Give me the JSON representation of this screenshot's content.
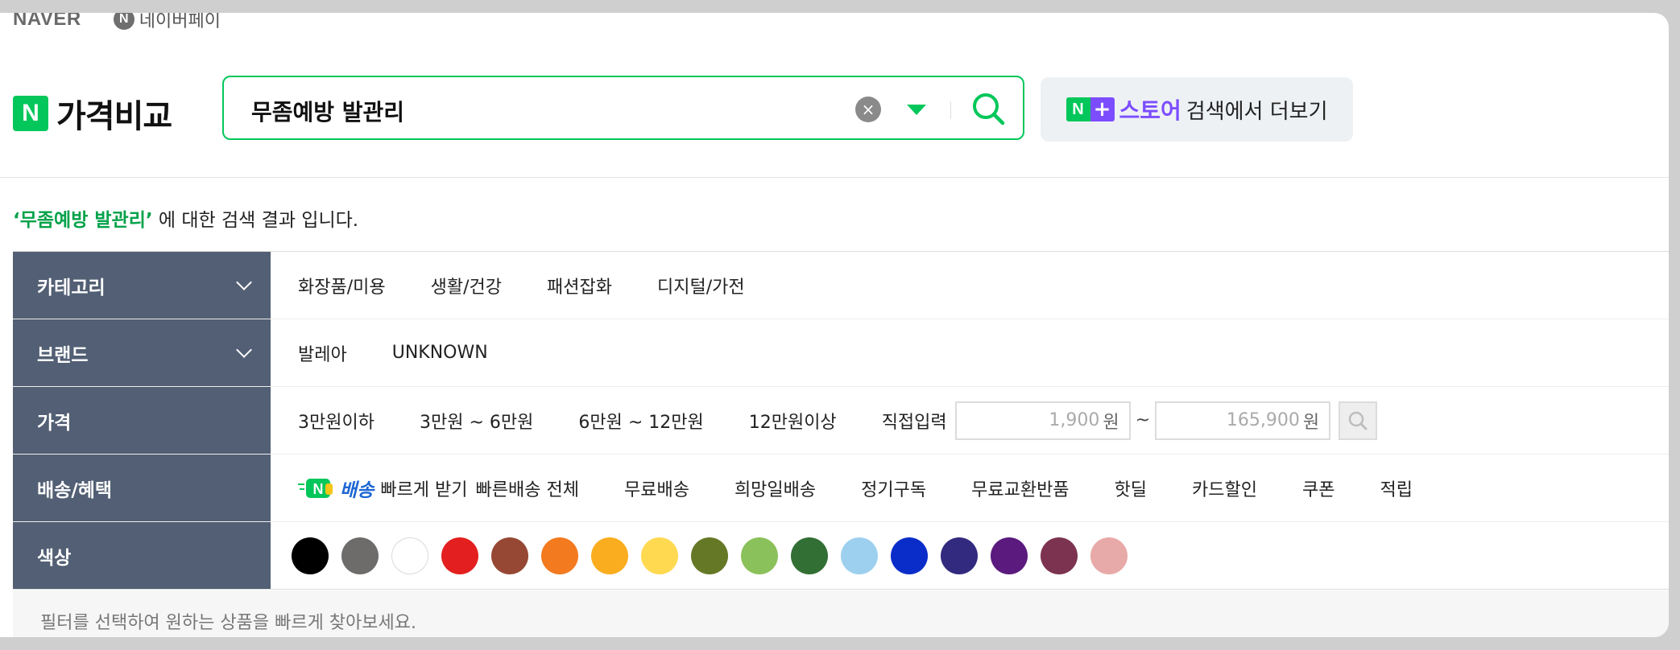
{
  "top": {
    "naver": "NAVER",
    "npay_icon": "N",
    "npay": "네이버페이"
  },
  "brand": {
    "icon": "N",
    "title": "가격비교"
  },
  "search": {
    "query": "무좀예방 발관리",
    "clear_icon": "×"
  },
  "store": {
    "n": "N",
    "plus": "+",
    "name": "스토어",
    "rest": "검색에서 더보기"
  },
  "result": {
    "keyword": "‘무좀예방 발관리’",
    "text": " 에 대한 검색 결과 입니다."
  },
  "filters": {
    "category": {
      "label": "카테고리",
      "items": [
        "화장품/미용",
        "생활/건강",
        "패션잡화",
        "디지털/가전"
      ]
    },
    "brand": {
      "label": "브랜드",
      "items": [
        "발레아",
        "UNKNOWN"
      ]
    },
    "price": {
      "label": "가격",
      "items": [
        "3만원이하",
        "3만원 ~ 6만원",
        "6만원 ~ 12만원",
        "12만원이상"
      ],
      "direct": "직접입력",
      "min_placeholder": "1,900",
      "max_placeholder": "165,900",
      "won": "원",
      "tilde": "~"
    },
    "delivery": {
      "label": "배송/혜택",
      "badge": "배송",
      "fast": "빠르게 받기",
      "items": [
        "빠른배송 전체",
        "무료배송",
        "희망일배송",
        "정기구독",
        "무료교환반품",
        "핫딜",
        "카드할인",
        "쿠폰",
        "적립"
      ]
    },
    "color": {
      "label": "색상",
      "swatches": [
        "#000000",
        "#6e6b6b",
        "#ffffff",
        "#e3201f",
        "#964834",
        "#f37a1f",
        "#f9ad1f",
        "#ffd950",
        "#657826",
        "#8bc15b",
        "#326f34",
        "#9dd0ee",
        "#0a2dc9",
        "#322a7e",
        "#5a1a7e",
        "#7c3350",
        "#e8aaa8"
      ]
    }
  },
  "hint": "필터를 선택하여 원하는 상품을 빠르게 찾아보세요.",
  "colors": {
    "accent": "#03c75a",
    "store": "#7c4dff",
    "sidebar": "#525f74",
    "delivery": "#1c66d3"
  }
}
